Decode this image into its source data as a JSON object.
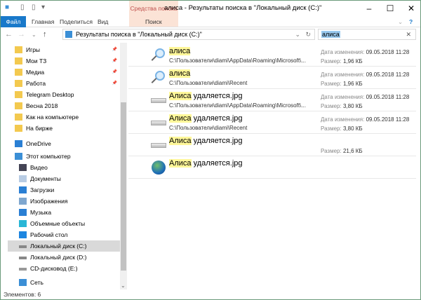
{
  "window": {
    "title": "алиса - Результаты поиска в \"Локальный диск (C:)\"",
    "context_tab_group": "Средства поиска"
  },
  "ribbon": {
    "tabs": [
      "Файл",
      "Главная",
      "Поделиться",
      "Вид",
      "Поиск"
    ]
  },
  "address": {
    "path": "Результаты поиска в \"Локальный диск (C:)\"",
    "search_value": "алиса"
  },
  "sidebar": {
    "items": [
      {
        "label": "Игры",
        "icon": "folder-icon",
        "pinned": true
      },
      {
        "label": "Мои ТЗ",
        "icon": "folder-icon",
        "pinned": true
      },
      {
        "label": "Медиа",
        "icon": "folder-icon",
        "pinned": true
      },
      {
        "label": "Работа",
        "icon": "folder-icon",
        "pinned": true
      },
      {
        "label": "Telegram Desktop",
        "icon": "folder-icon"
      },
      {
        "label": "Весна 2018",
        "icon": "folder-icon"
      },
      {
        "label": "Как на компьютере",
        "icon": "folder-icon"
      },
      {
        "label": "На бирже",
        "icon": "folder-icon"
      },
      {
        "label": "OneDrive",
        "icon": "cloud-icon"
      },
      {
        "label": "Этот компьютер",
        "icon": "computer-icon"
      },
      {
        "label": "Видео",
        "icon": "video-icon"
      },
      {
        "label": "Документы",
        "icon": "documents-icon"
      },
      {
        "label": "Загрузки",
        "icon": "downloads-icon"
      },
      {
        "label": "Изображения",
        "icon": "pictures-icon"
      },
      {
        "label": "Музыка",
        "icon": "music-icon"
      },
      {
        "label": "Объемные объекты",
        "icon": "3d-objects-icon"
      },
      {
        "label": "Рабочий стол",
        "icon": "desktop-icon"
      },
      {
        "label": "Локальный диск (C:)",
        "icon": "drive-icon",
        "selected": true
      },
      {
        "label": "Локальный диск (D:)",
        "icon": "drive-icon"
      },
      {
        "label": "CD-дисковод (E:)",
        "icon": "cd-drive-icon"
      },
      {
        "label": "Сеть",
        "icon": "network-icon"
      }
    ]
  },
  "results": [
    {
      "match": "алиса",
      "rest": "",
      "path": "C:\\Пользователи\\diami\\AppData\\Roaming\\Microsoft\\...",
      "date_label": "Дата изменения:",
      "date": "09.05.2018 11:28",
      "size_label": "Размер:",
      "size": "1,96 КБ",
      "icon": "search-icon"
    },
    {
      "match": "алиса",
      "rest": "",
      "path": "C:\\Пользователи\\diami\\Recent",
      "date_label": "Дата изменения:",
      "date": "09.05.2018 11:28",
      "size_label": "Размер:",
      "size": "1,96 КБ",
      "icon": "search-icon"
    },
    {
      "match": "Алиса",
      "rest": " удаляется.jpg",
      "path": "C:\\Пользователи\\diami\\AppData\\Roaming\\Microsoft\\...",
      "date_label": "Дата изменения:",
      "date": "09.05.2018 11:28",
      "size_label": "Размер:",
      "size": "3,80 КБ",
      "icon": "shortcut-icon"
    },
    {
      "match": "Алиса",
      "rest": " удаляется.jpg",
      "path": "C:\\Пользователи\\diami\\Recent",
      "date_label": "Дата изменения:",
      "date": "09.05.2018 11:28",
      "size_label": "Размер:",
      "size": "3,80 КБ",
      "icon": "shortcut-icon"
    },
    {
      "match": "Алиса",
      "rest": " удаляется.jpg",
      "size_label": "Размер:",
      "size": "21,6 КБ",
      "icon": "shortcut-icon"
    },
    {
      "match": "Алиса",
      "rest": " удаляется.jpg",
      "icon": "globe-icon"
    }
  ],
  "status": {
    "count": "Элементов: 6"
  },
  "colors": {
    "accent": "#1979ca",
    "highlight": "#fff799",
    "context_tab": "#fbe3d6"
  }
}
